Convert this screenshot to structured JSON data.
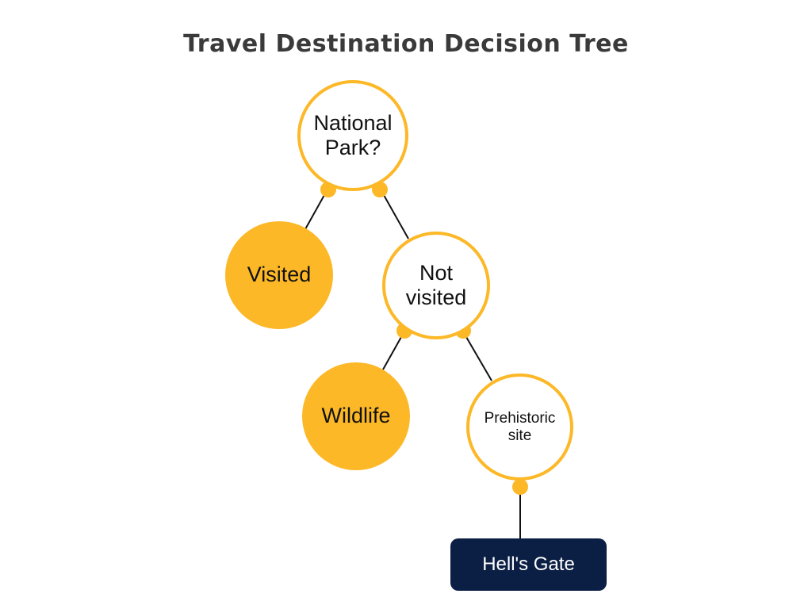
{
  "title": "Travel Destination Decision Tree",
  "colors": {
    "accent": "#fcb827",
    "leaf_box": "#0b1f44",
    "edge": "#111111",
    "text": "#111111"
  },
  "nodes": {
    "national_park": {
      "line1": "National",
      "line2": "Park?"
    },
    "visited": {
      "label": "Visited"
    },
    "not_visited": {
      "line1": "Not",
      "line2": "visited"
    },
    "wildlife": {
      "label": "Wildlife"
    },
    "prehistoric_site": {
      "line1": "Prehistoric",
      "line2": "site"
    },
    "hells_gate": {
      "label": "Hell's Gate"
    }
  }
}
